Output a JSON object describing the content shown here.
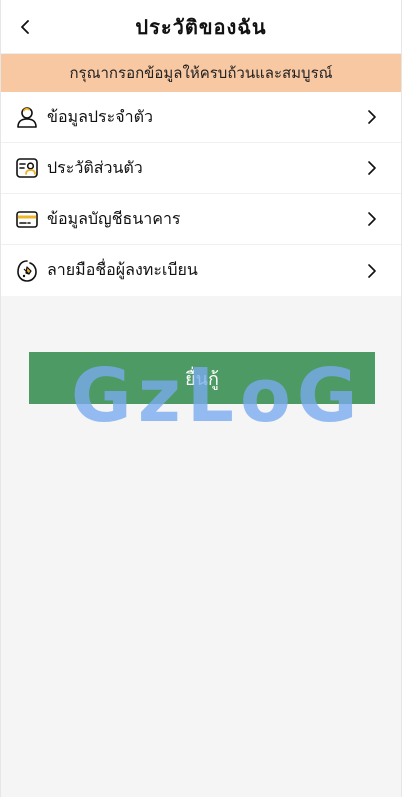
{
  "header": {
    "title": "ประวัติของฉัน"
  },
  "notice": {
    "text": "กรุณากรอกข้อมูลให้ครบถ้วนและสมบูรณ์"
  },
  "menu": {
    "items": [
      {
        "label": "ข้อมูลประจำตัว",
        "icon": "person-icon"
      },
      {
        "label": "ประวัติส่วนตัว",
        "icon": "profile-card-icon"
      },
      {
        "label": "ข้อมูลบัญชีธนาคาร",
        "icon": "bank-card-icon"
      },
      {
        "label": "ลายมือชื่อผู้ลงทะเบียน",
        "icon": "signature-icon"
      }
    ]
  },
  "submit": {
    "label": "ยื่นกู้"
  },
  "watermark": {
    "text": "GzLoG"
  },
  "colors": {
    "accent": "#4e9a64",
    "notice_bg": "#f8c8a3",
    "icon_yellow": "#f0b429"
  }
}
